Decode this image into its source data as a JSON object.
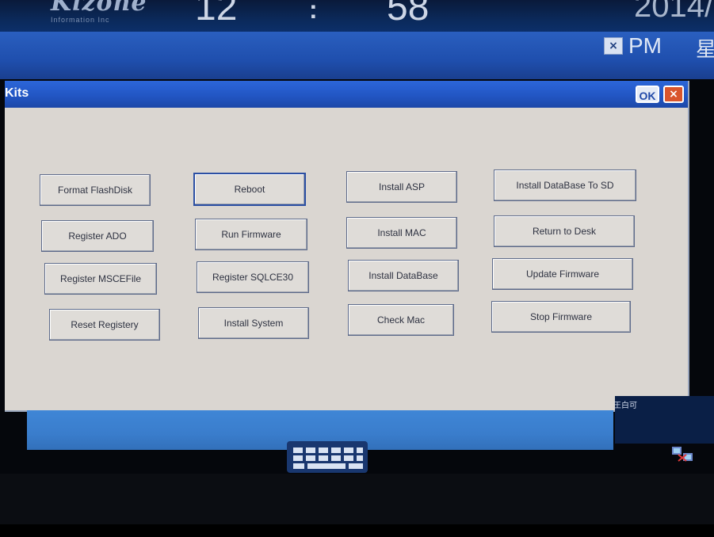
{
  "status": {
    "brand": "Kizone",
    "brand_sub": "Information Inc",
    "clock_hour": "12",
    "clock_sep": ":",
    "clock_minute": "58",
    "date_fragment": "2014/"
  },
  "background_window": {
    "ampm_fragment": "PM",
    "close_glyph": "×",
    "trailing_char": "星"
  },
  "dialog": {
    "title": "Kits",
    "ok_label": "OK",
    "close_glyph": "×",
    "buttons": [
      {
        "label": "Format FlashDisk"
      },
      {
        "label": "Reboot"
      },
      {
        "label": "Install ASP"
      },
      {
        "label": "Install DataBase To SD"
      },
      {
        "label": "Register ADO"
      },
      {
        "label": "Run Firmware"
      },
      {
        "label": "Install MAC"
      },
      {
        "label": "Return to Desk"
      },
      {
        "label": "Register MSCEFile"
      },
      {
        "label": "Register SQLCE30"
      },
      {
        "label": "Install DataBase"
      },
      {
        "label": "Update Firmware"
      },
      {
        "label": "Reset Registery"
      },
      {
        "label": "Install System"
      },
      {
        "label": "Check Mac"
      },
      {
        "label": "Stop Firmware"
      }
    ]
  },
  "taskbar": {
    "ime_label": "王白可",
    "keyboard_icon": "keyboard-icon",
    "network_icon": "network-icon"
  },
  "colors": {
    "title_blue": "#2256c4",
    "dialog_bg": "#dad6d1",
    "close_red": "#d9552c"
  }
}
